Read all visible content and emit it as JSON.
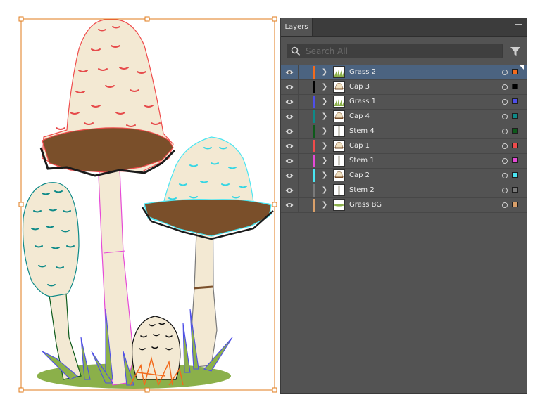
{
  "panel": {
    "tab_label": "Layers",
    "search_placeholder": "Search All",
    "menu_icon": "hamburger-menu-icon",
    "filter_icon": "funnel-filter-icon"
  },
  "layers": [
    {
      "name": "Grass 2",
      "color": "#f26b1d",
      "selected": true,
      "thumb": "grass"
    },
    {
      "name": "Cap 3",
      "color": "#000000",
      "selected": false,
      "thumb": "cap"
    },
    {
      "name": "Grass 1",
      "color": "#4f4fe8",
      "selected": false,
      "thumb": "grass"
    },
    {
      "name": "Cap 4",
      "color": "#0e8a88",
      "selected": false,
      "thumb": "cap"
    },
    {
      "name": "Stem 4",
      "color": "#0d5a1a",
      "selected": false,
      "thumb": "stem"
    },
    {
      "name": "Cap 1",
      "color": "#ef4b4b",
      "selected": false,
      "thumb": "cap"
    },
    {
      "name": "Stem 1",
      "color": "#e64ad7",
      "selected": false,
      "thumb": "stem"
    },
    {
      "name": "Cap 2",
      "color": "#4ae6f2",
      "selected": false,
      "thumb": "cap"
    },
    {
      "name": "Stem 2",
      "color": "#7a7a7a",
      "selected": false,
      "thumb": "stem"
    },
    {
      "name": "Grass BG",
      "color": "#d9a06a",
      "selected": false,
      "thumb": "grassbg"
    }
  ]
}
